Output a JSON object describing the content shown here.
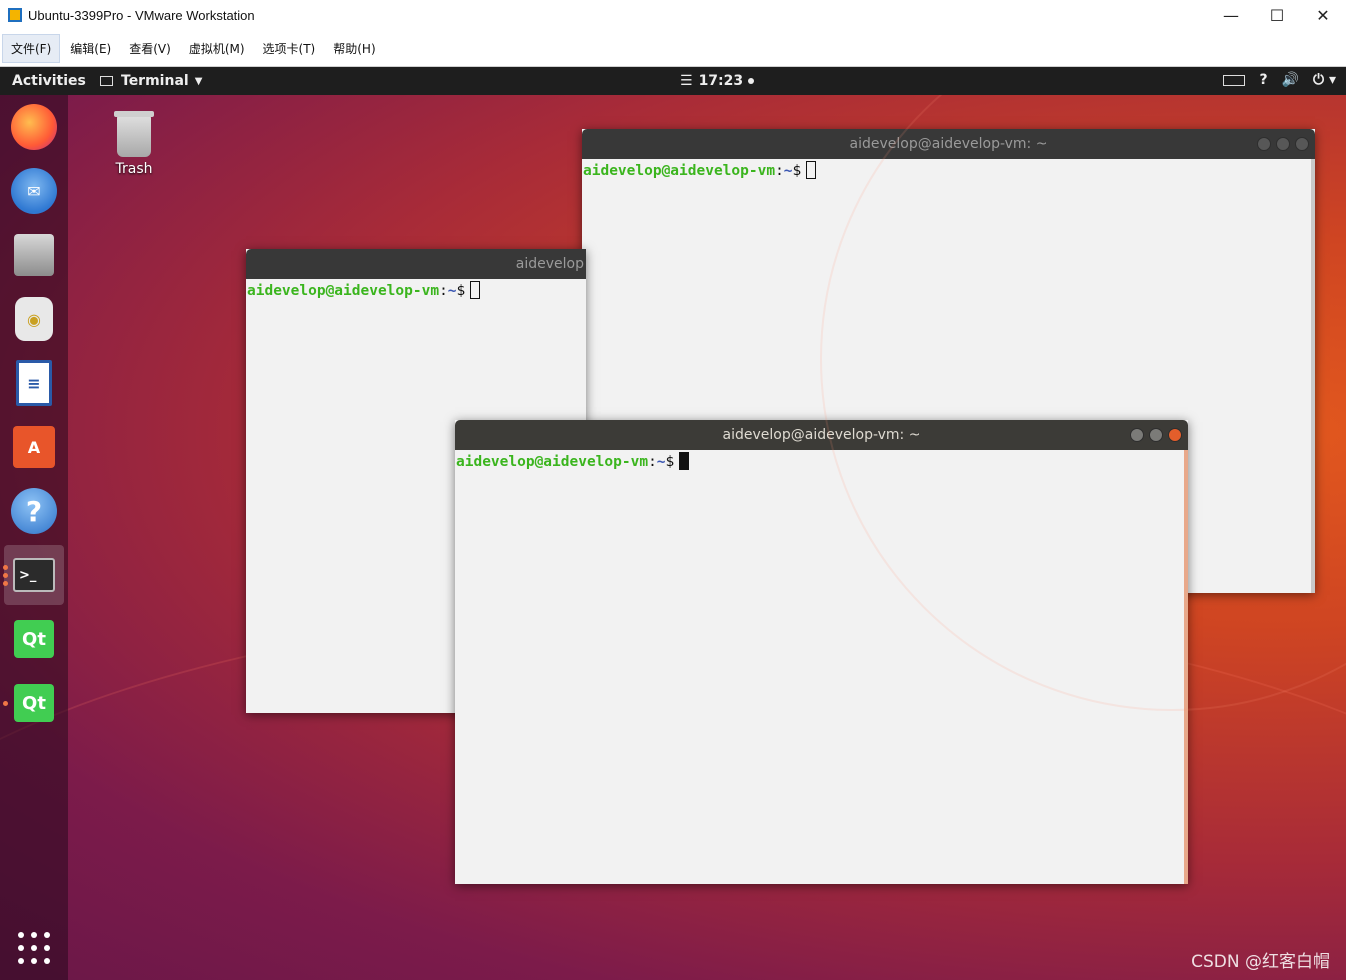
{
  "vmware": {
    "title": "Ubuntu-3399Pro - VMware Workstation",
    "window_controls": [
      "—",
      "☐",
      "✕"
    ],
    "menus": [
      "文件(F)",
      "编辑(E)",
      "查看(V)",
      "虚拟机(M)",
      "选项卡(T)",
      "帮助(H)"
    ]
  },
  "topbar": {
    "activities": "Activities",
    "app_name": "Terminal",
    "clock": "17:23",
    "tray_icons": [
      "keyboard-icon",
      "accessibility-icon",
      "volume-icon",
      "power-icon"
    ]
  },
  "dock": {
    "apps": [
      {
        "name": "firefox-icon",
        "color": "#ff7139"
      },
      {
        "name": "thunderbird-icon",
        "color": "#2f78d2"
      },
      {
        "name": "files-icon",
        "color": "#8c8c8c"
      },
      {
        "name": "rhythmbox-icon",
        "color": "#e8c237"
      },
      {
        "name": "libreoffice-writer-icon",
        "color": "#2a5aa8"
      },
      {
        "name": "software-center-icon",
        "color": "#e8552a"
      },
      {
        "name": "help-icon",
        "color": "#3a8ad8"
      },
      {
        "name": "terminal-icon",
        "color": "#2b2b2b"
      },
      {
        "name": "qt-creator-icon",
        "color": "#41cd52",
        "label": "Qt"
      },
      {
        "name": "qt-designer-icon",
        "color": "#41cd52",
        "label": "Qt"
      }
    ]
  },
  "desktop": {
    "trash_label": "Trash"
  },
  "terminals": [
    {
      "title": "aidevelop@aidevelop-vm: ~",
      "user": "aidevelop@aidevelop-vm",
      "sep": ":",
      "path": "~",
      "sym": "$",
      "focused": false
    },
    {
      "title": "aidevelop",
      "user": "aidevelop@aidevelop-vm",
      "sep": ":",
      "path": "~",
      "sym": "$",
      "focused": false
    },
    {
      "title": "aidevelop@aidevelop-vm: ~",
      "user": "aidevelop@aidevelop-vm",
      "sep": ":",
      "path": "~",
      "sym": "$",
      "focused": true
    }
  ],
  "watermark": "CSDN @红客白帽"
}
